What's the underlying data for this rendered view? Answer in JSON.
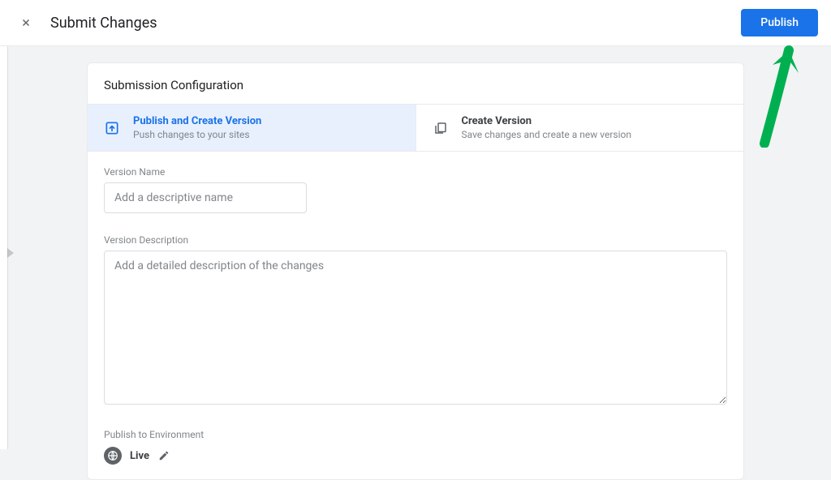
{
  "header": {
    "title": "Submit Changes",
    "publish_button": "Publish"
  },
  "card": {
    "title": "Submission Configuration"
  },
  "options": [
    {
      "title": "Publish and Create Version",
      "subtitle": "Push changes to your sites"
    },
    {
      "title": "Create Version",
      "subtitle": "Save changes and create a new version"
    }
  ],
  "form": {
    "version_name_label": "Version Name",
    "version_name_placeholder": "Add a descriptive name",
    "version_desc_label": "Version Description",
    "version_desc_placeholder": "Add a detailed description of the changes",
    "publish_env_label": "Publish to Environment",
    "env_name": "Live"
  }
}
